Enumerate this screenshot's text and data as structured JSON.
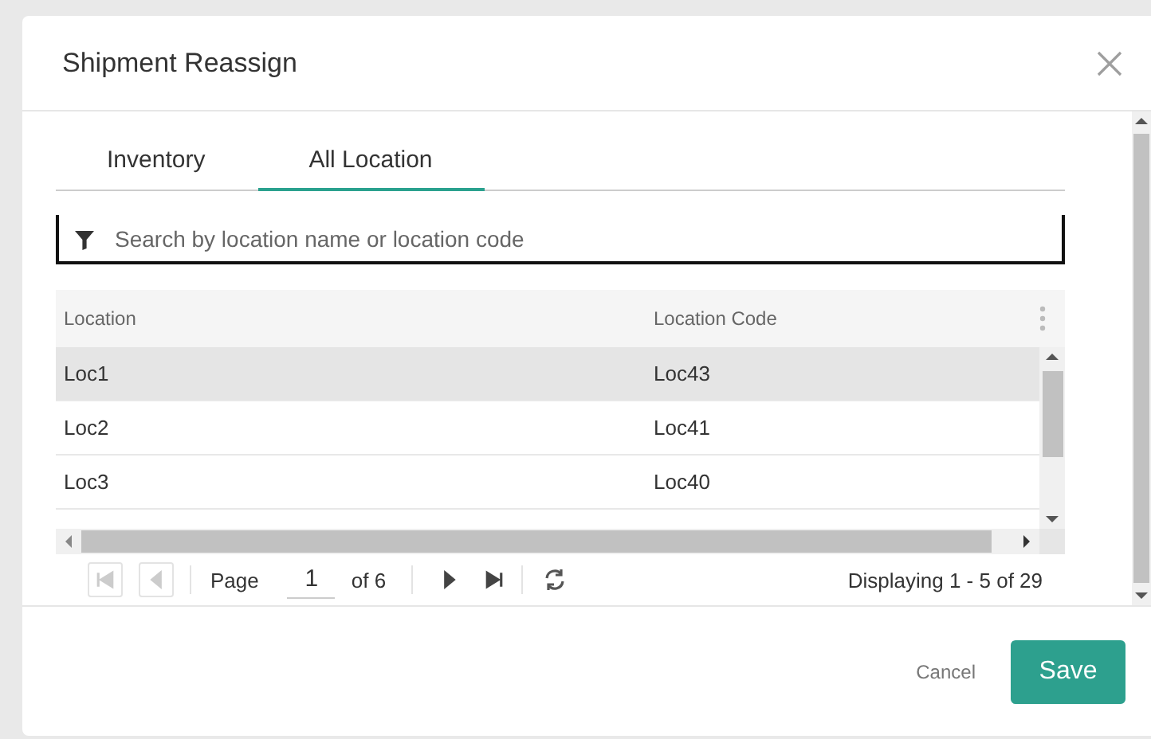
{
  "dialog": {
    "title": "Shipment Reassign"
  },
  "tabs": [
    {
      "label": "Inventory",
      "selected": false
    },
    {
      "label": "All Location",
      "selected": true
    }
  ],
  "search": {
    "placeholder": "Search by location name or location code"
  },
  "table": {
    "columns": [
      "Location",
      "Location Code"
    ],
    "rows": [
      {
        "cells": [
          "Loc1",
          "Loc43"
        ],
        "selected": true
      },
      {
        "cells": [
          "Loc2",
          "Loc41"
        ],
        "selected": false
      },
      {
        "cells": [
          "Loc3",
          "Loc40"
        ],
        "selected": false
      }
    ]
  },
  "pager": {
    "page_label": "Page",
    "page": "1",
    "page_count": "of 6",
    "summary": "Displaying 1 - 5 of 29",
    "nav": [
      {
        "kind": "first",
        "disabled": true
      },
      {
        "kind": "prev",
        "disabled": true
      },
      {
        "kind": "next",
        "disabled": false
      },
      {
        "kind": "last",
        "disabled": false
      }
    ]
  },
  "buttons": [
    {
      "label": "Cancel",
      "kind": "text"
    },
    {
      "label": "Save",
      "kind": "primary"
    }
  ]
}
